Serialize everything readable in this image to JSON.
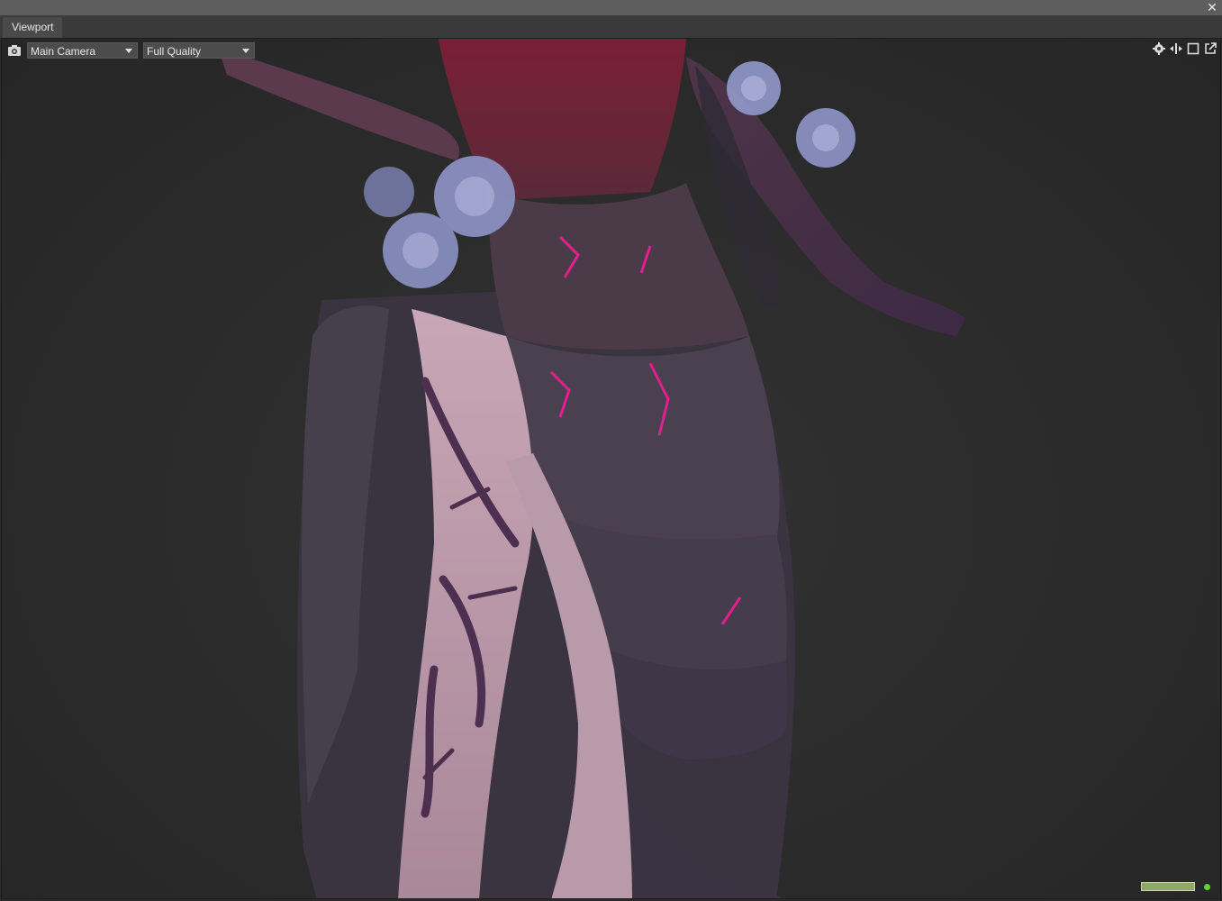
{
  "window": {
    "close_label": "✕"
  },
  "tabs": [
    {
      "label": "Viewport"
    }
  ],
  "viewport_toolbar": {
    "camera_icon": "camera-icon",
    "camera_select": {
      "value": "Main Camera"
    },
    "quality_select": {
      "value": "Full Quality"
    },
    "right_icons": [
      "settings-icon",
      "fit-view-icon",
      "maximize-icon",
      "popout-icon"
    ]
  },
  "status": {
    "indicator_color": "#8fa86a",
    "dot_color": "#5fd630"
  },
  "colors": {
    "background": "#2a2a2a",
    "titlebar": "#5e5e5e",
    "tab": "#4a4a4a"
  }
}
